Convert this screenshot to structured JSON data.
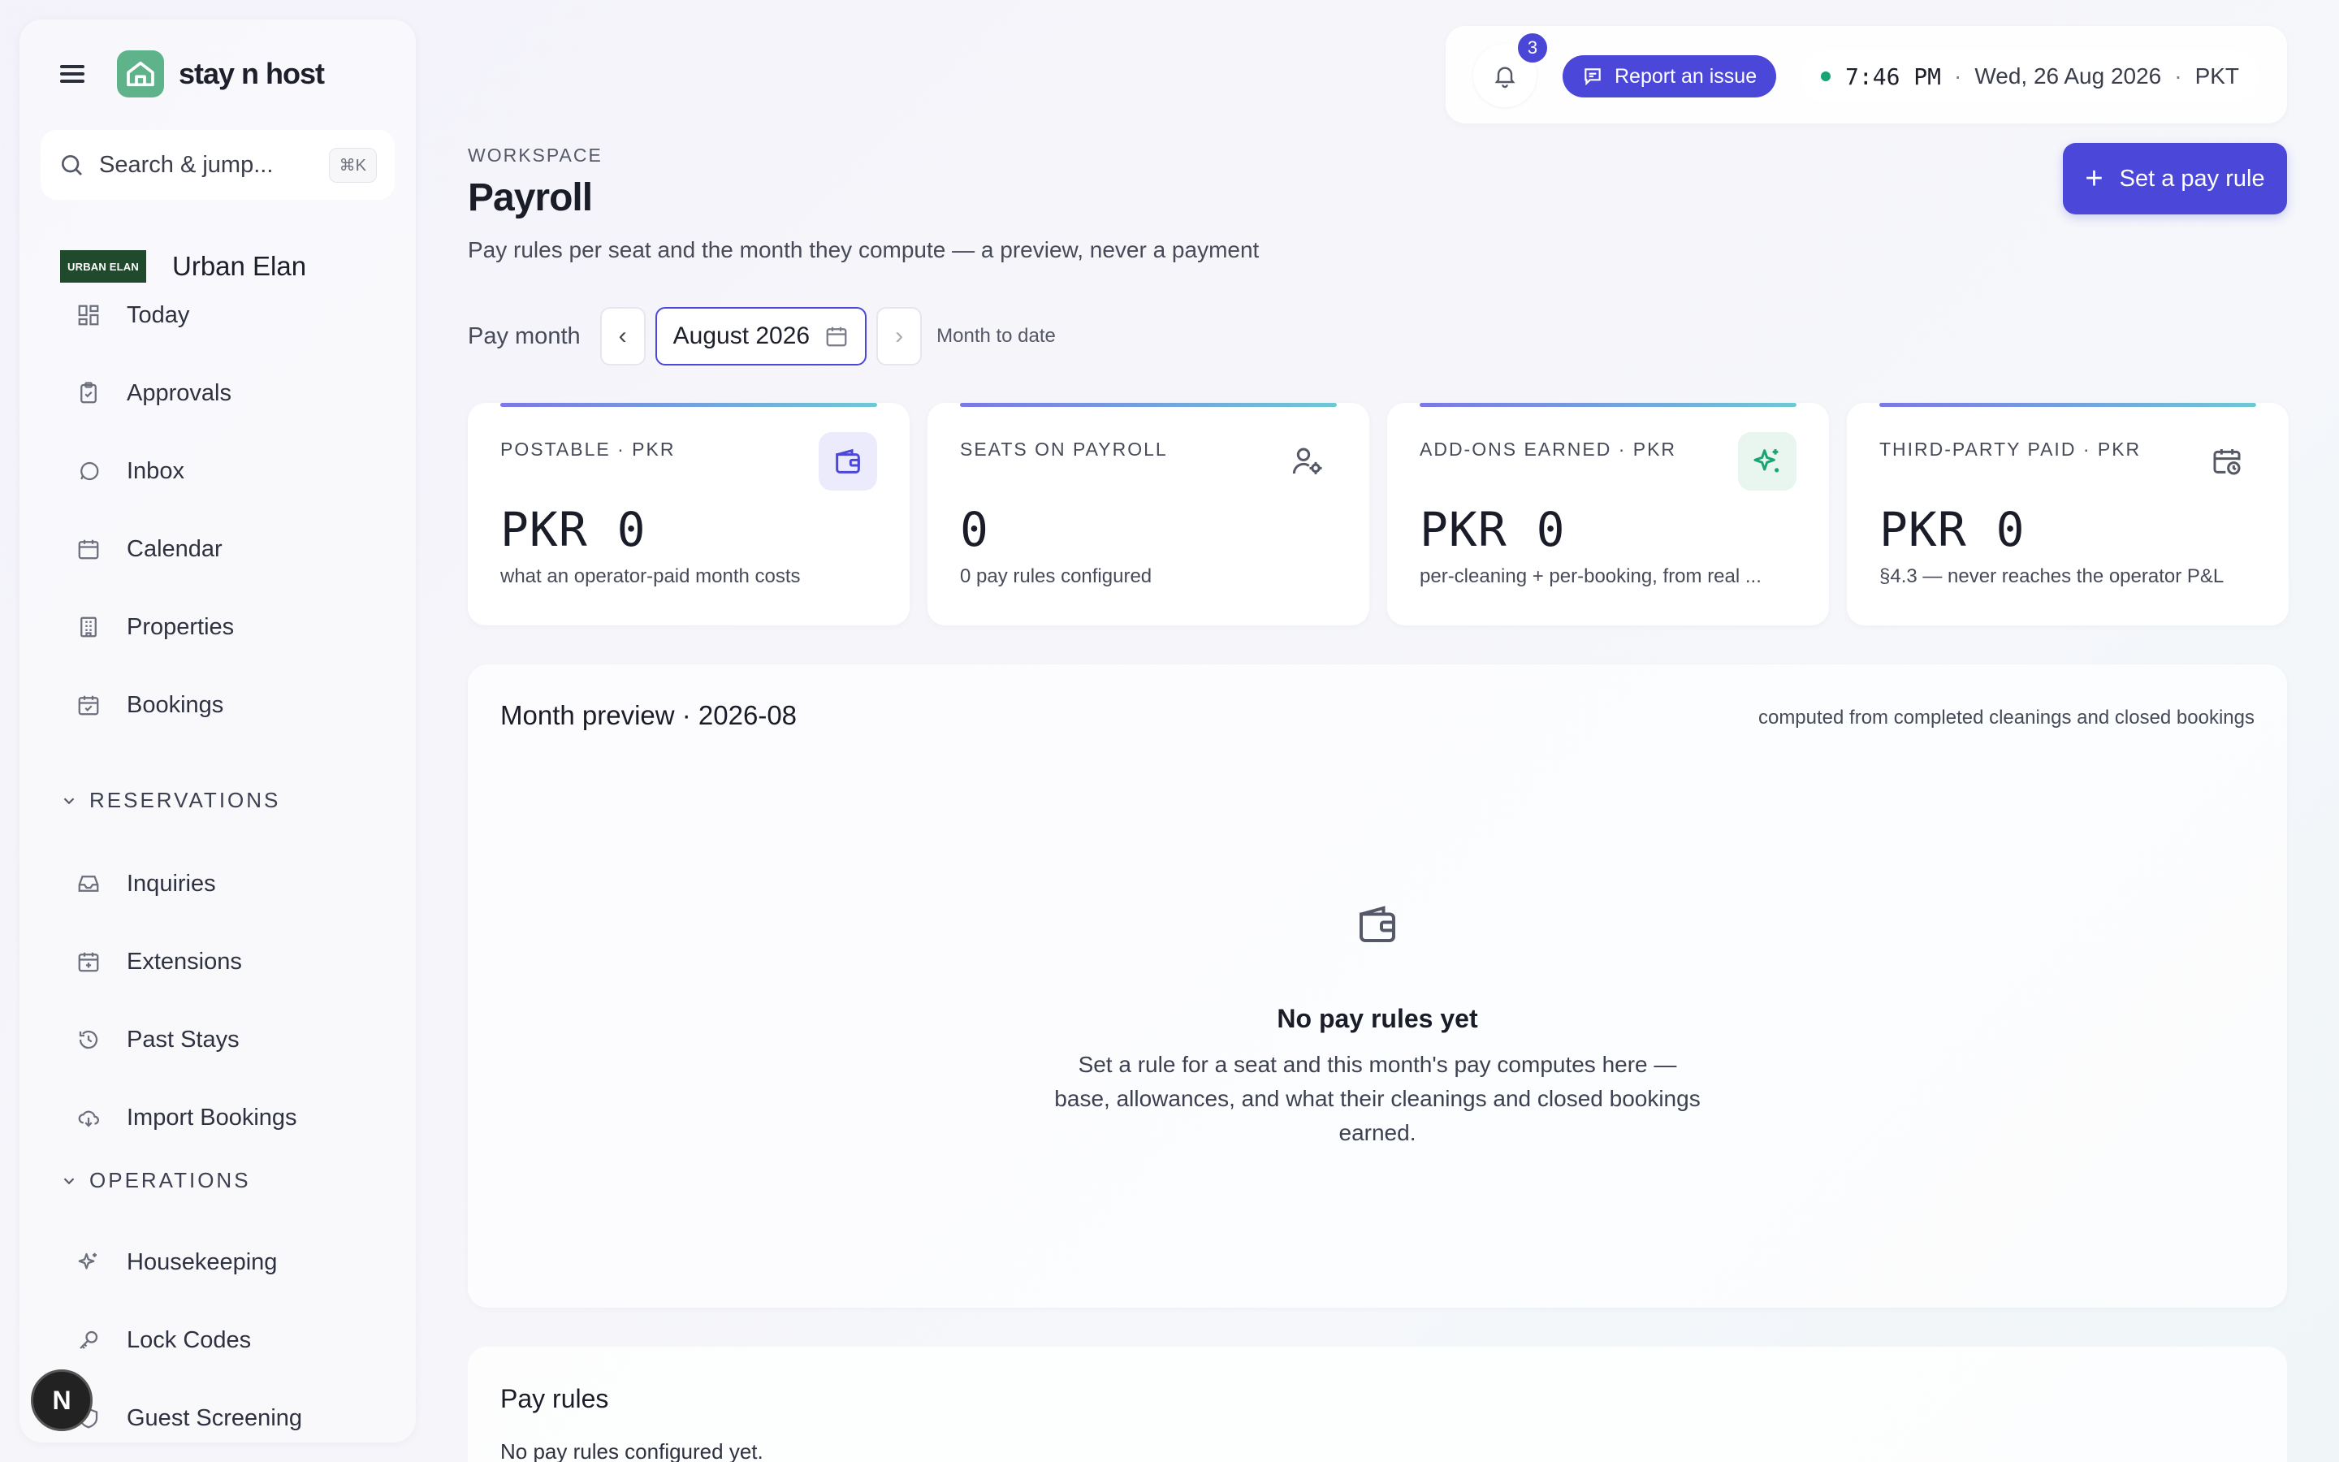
{
  "brand": {
    "name": "stay n host"
  },
  "search": {
    "placeholder": "Search & jump...",
    "shortcut": "⌘K"
  },
  "org": {
    "logo_text": "URBAN ELAN",
    "name": "Urban Elan"
  },
  "sidebar": {
    "items": [
      {
        "label": "Today",
        "icon": "dashboard-grid-icon"
      },
      {
        "label": "Approvals",
        "icon": "clipboard-check-icon"
      },
      {
        "label": "Inbox",
        "icon": "message-circle-icon"
      },
      {
        "label": "Calendar",
        "icon": "calendar-icon"
      },
      {
        "label": "Properties",
        "icon": "building-icon"
      },
      {
        "label": "Bookings",
        "icon": "calendar-check-icon"
      }
    ],
    "sections": [
      {
        "title": "RESERVATIONS",
        "items": [
          {
            "label": "Inquiries",
            "icon": "inbox-tray-icon"
          },
          {
            "label": "Extensions",
            "icon": "calendar-plus-icon"
          },
          {
            "label": "Past Stays",
            "icon": "history-icon"
          },
          {
            "label": "Import Bookings",
            "icon": "cloud-download-icon"
          }
        ]
      },
      {
        "title": "OPERATIONS",
        "items": [
          {
            "label": "Housekeeping",
            "icon": "sparkles-icon"
          },
          {
            "label": "Lock Codes",
            "icon": "key-icon"
          },
          {
            "label": "Guest Screening",
            "icon": "shield-icon"
          }
        ]
      }
    ]
  },
  "avatar": {
    "initial": "N"
  },
  "topbar": {
    "notifications_count": "3",
    "report_label": "Report an issue",
    "time": "7:46 PM",
    "date": "Wed, 26 Aug 2026",
    "timezone": "PKT",
    "separator": "·"
  },
  "header": {
    "crumb": "WORKSPACE",
    "title": "Payroll",
    "subtitle": "Pay rules per seat and the month they compute — a preview, never a payment",
    "primary_action": "Set a pay rule",
    "primary_action_icon": "+"
  },
  "pay_month": {
    "label": "Pay month",
    "prev": "‹",
    "next": "›",
    "value": "August 2026",
    "mode": "Month to date"
  },
  "stats": [
    {
      "label": "POSTABLE · PKR",
      "value": "PKR 0",
      "hint": "what an operator-paid month costs",
      "icon": "wallet-icon",
      "icon_bg": "#ecebfb",
      "icon_color": "#4b47d8"
    },
    {
      "label": "SEATS ON PAYROLL",
      "value": "0",
      "hint": "0 pay rules configured",
      "icon": "user-cog-icon",
      "icon_bg": "#ffffff",
      "icon_color": "#555866"
    },
    {
      "label": "ADD-ONS EARNED · PKR",
      "value": "PKR 0",
      "hint": "per-cleaning + per-booking, from real ...",
      "icon": "sparkles-icon",
      "icon_bg": "#e8f6ef",
      "icon_color": "#17a673"
    },
    {
      "label": "THIRD-PARTY PAID · PKR",
      "value": "PKR 0",
      "hint": "§4.3 — never reaches the operator P&L",
      "icon": "calendar-clock-icon",
      "icon_bg": "#ffffff",
      "icon_color": "#555866"
    }
  ],
  "preview": {
    "title": "Month preview · 2026-08",
    "note": "computed from completed cleanings and closed bookings",
    "empty_title": "No pay rules yet",
    "empty_text": "Set a rule for a seat and this month's pay computes here — base, allowances, and what their cleanings and closed bookings earned."
  },
  "pay_rules": {
    "title": "Pay rules",
    "empty": "No pay rules configured yet."
  },
  "colors": {
    "accent": "#4b47d8",
    "brand_green": "#5fb38a",
    "status_green": "#17a673"
  }
}
